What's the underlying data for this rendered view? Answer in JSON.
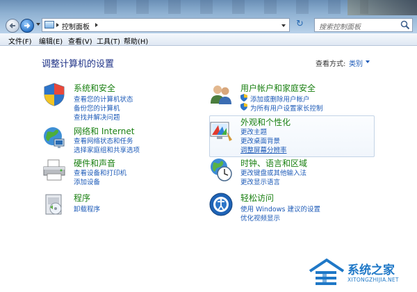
{
  "address": {
    "location": "控制面板"
  },
  "search": {
    "placeholder": "搜索控制面板"
  },
  "menu": [
    "文件(F)",
    "编辑(E)",
    "查看(V)",
    "工具(T)",
    "帮助(H)"
  ],
  "page": {
    "title": "调整计算机的设置",
    "view_by_label": "查看方式:",
    "view_by_value": "类别"
  },
  "categories": {
    "system": {
      "title": "系统和安全",
      "links": [
        "查看您的计算机状态",
        "备份您的计算机",
        "查找并解决问题"
      ]
    },
    "network": {
      "title": "网络和 Internet",
      "links": [
        "查看网络状态和任务",
        "选择家庭组和共享选项"
      ]
    },
    "hardware": {
      "title": "硬件和声音",
      "links": [
        "查看设备和打印机",
        "添加设备"
      ]
    },
    "programs": {
      "title": "程序",
      "links": [
        "卸载程序"
      ]
    },
    "users": {
      "title": "用户帐户和家庭安全",
      "links": [
        "添加或删除用户帐户",
        "为所有用户设置家长控制"
      ]
    },
    "appearance": {
      "title": "外观和个性化",
      "links": [
        "更改主题",
        "更改桌面背景",
        "调整屏幕分辨率"
      ]
    },
    "clock": {
      "title": "时钟、语言和区域",
      "links": [
        "更改键盘或其他输入法",
        "更改显示语言"
      ]
    },
    "ease": {
      "title": "轻松访问",
      "links": [
        "使用 Windows 建议的设置",
        "优化视频显示"
      ]
    }
  },
  "watermark": {
    "name": "系统之家",
    "url": "XITONGZHIJIA.NET"
  }
}
